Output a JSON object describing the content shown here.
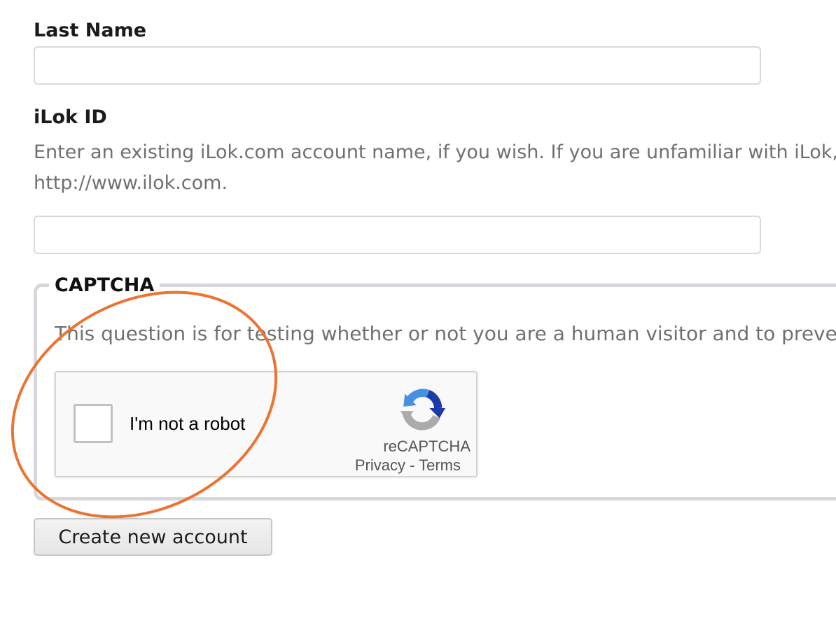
{
  "form": {
    "last_name": {
      "label": "Last Name",
      "value": "",
      "placeholder": ""
    },
    "ilok_id": {
      "label": "iLok ID",
      "description_line1": "Enter an existing iLok.com account name, if you wish. If you are unfamiliar with iLok,",
      "description_line2": "http://www.ilok.com.",
      "value": "",
      "placeholder": ""
    },
    "captcha": {
      "legend": "CAPTCHA",
      "description": "This question is for testing whether or not you are a human visitor and to prevent automated spam submissions.",
      "recaptcha": {
        "checkbox_label": "I'm not a robot",
        "brand": "reCAPTCHA",
        "privacy_link": "Privacy",
        "separator": " - ",
        "terms_link": "Terms",
        "logo_icon": "recaptcha-logo-icon"
      }
    },
    "submit_label": "Create new account"
  },
  "annotation": {
    "color": "#EC7432",
    "shape": "ellipse"
  },
  "colors": {
    "label_text": "#1b1b1b",
    "description_text": "#707070",
    "input_border": "#d9d9d9",
    "fieldset_border": "#d7d7dd",
    "recaptcha_blue": "#4A90E2",
    "recaptcha_dark_blue": "#1C3AA9",
    "recaptcha_gray": "#ABABAB"
  }
}
